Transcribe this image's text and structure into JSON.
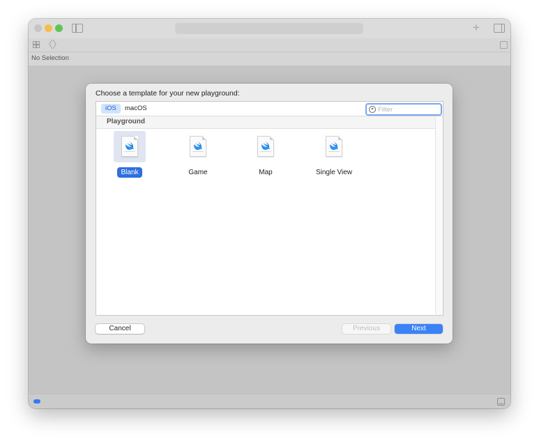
{
  "window": {
    "path_text": "No Selection",
    "toolbar_icons": [
      "sidebar-icon",
      "plus-icon",
      "inspector-icon"
    ],
    "nav_icons": [
      "grid-icon",
      "chevron-left-icon",
      "chevron-right-icon",
      "related-items-icon"
    ],
    "back_glyph": "〈",
    "forward_glyph": "〉",
    "plus_glyph": "+"
  },
  "sheet": {
    "title": "Choose a template for your new playground:",
    "tabs": [
      {
        "label": "iOS",
        "selected": true
      },
      {
        "label": "macOS",
        "selected": false
      }
    ],
    "filter": {
      "placeholder": "Filter",
      "value": "",
      "icon": "filter-icon"
    },
    "section_header": "Playground",
    "templates": [
      {
        "label": "Blank",
        "selected": true,
        "icon": "swift-playground-icon"
      },
      {
        "label": "Game",
        "selected": false,
        "icon": "swift-playground-icon"
      },
      {
        "label": "Map",
        "selected": false,
        "icon": "swift-playground-icon"
      },
      {
        "label": "Single View",
        "selected": false,
        "icon": "swift-playground-icon"
      }
    ],
    "buttons": {
      "cancel": "Cancel",
      "previous": "Previous",
      "next": "Next"
    }
  },
  "colors": {
    "accent": "#3b82f6",
    "selection": "#2f6fde",
    "ios_tab_bg": "#d2e4fb",
    "traffic_minimize": "#f5bd4f",
    "traffic_maximize": "#61c554"
  }
}
